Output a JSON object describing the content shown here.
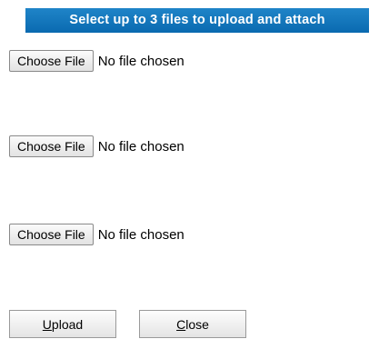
{
  "header": {
    "title": "Select up to 3 files to upload and attach"
  },
  "files": [
    {
      "button_label": "Choose File",
      "status": "No file chosen"
    },
    {
      "button_label": "Choose File",
      "status": "No file chosen"
    },
    {
      "button_label": "Choose File",
      "status": "No file chosen"
    }
  ],
  "actions": {
    "upload": {
      "mnemonic": "U",
      "rest": "pload"
    },
    "close": {
      "mnemonic": "C",
      "rest": "lose"
    }
  },
  "colors": {
    "header_bg": "#0a6ab0",
    "header_text": "#ffffff"
  }
}
